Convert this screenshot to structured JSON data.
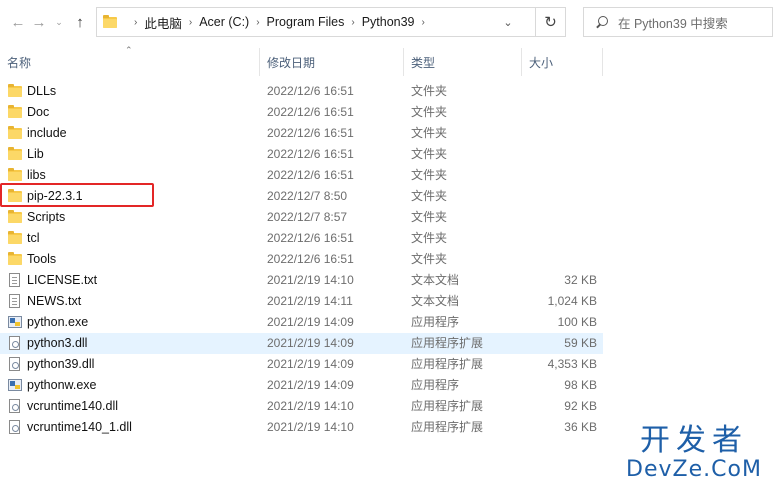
{
  "address_bar": {
    "breadcrumb": [
      "此电脑",
      "Acer (C:)",
      "Program Files",
      "Python39"
    ],
    "search_placeholder": "在 Python39 中搜索"
  },
  "columns": {
    "name": "名称",
    "date": "修改日期",
    "type": "类型",
    "size": "大小"
  },
  "files": [
    {
      "icon": "folder-icon",
      "name": "DLLs",
      "date": "2022/12/6 16:51",
      "type": "文件夹",
      "size": ""
    },
    {
      "icon": "folder-icon",
      "name": "Doc",
      "date": "2022/12/6 16:51",
      "type": "文件夹",
      "size": ""
    },
    {
      "icon": "folder-icon",
      "name": "include",
      "date": "2022/12/6 16:51",
      "type": "文件夹",
      "size": ""
    },
    {
      "icon": "folder-icon",
      "name": "Lib",
      "date": "2022/12/6 16:51",
      "type": "文件夹",
      "size": ""
    },
    {
      "icon": "folder-icon",
      "name": "libs",
      "date": "2022/12/6 16:51",
      "type": "文件夹",
      "size": ""
    },
    {
      "icon": "folder-icon",
      "name": "pip-22.3.1",
      "date": "2022/12/7 8:50",
      "type": "文件夹",
      "size": ""
    },
    {
      "icon": "folder-icon",
      "name": "Scripts",
      "date": "2022/12/7 8:57",
      "type": "文件夹",
      "size": ""
    },
    {
      "icon": "folder-icon",
      "name": "tcl",
      "date": "2022/12/6 16:51",
      "type": "文件夹",
      "size": ""
    },
    {
      "icon": "folder-icon",
      "name": "Tools",
      "date": "2022/12/6 16:51",
      "type": "文件夹",
      "size": ""
    },
    {
      "icon": "text-file-icon",
      "name": "LICENSE.txt",
      "date": "2021/2/19 14:10",
      "type": "文本文档",
      "size": "32 KB"
    },
    {
      "icon": "text-file-icon",
      "name": "NEWS.txt",
      "date": "2021/2/19 14:11",
      "type": "文本文档",
      "size": "1,024 KB"
    },
    {
      "icon": "exe-file-icon",
      "name": "python.exe",
      "date": "2021/2/19 14:09",
      "type": "应用程序",
      "size": "100 KB"
    },
    {
      "icon": "dll-file-icon",
      "name": "python3.dll",
      "date": "2021/2/19 14:09",
      "type": "应用程序扩展",
      "size": "59 KB",
      "selected": true
    },
    {
      "icon": "dll-file-icon",
      "name": "python39.dll",
      "date": "2021/2/19 14:09",
      "type": "应用程序扩展",
      "size": "4,353 KB"
    },
    {
      "icon": "exe-file-icon",
      "name": "pythonw.exe",
      "date": "2021/2/19 14:09",
      "type": "应用程序",
      "size": "98 KB"
    },
    {
      "icon": "dll-file-icon",
      "name": "vcruntime140.dll",
      "date": "2021/2/19 14:10",
      "type": "应用程序扩展",
      "size": "92 KB"
    },
    {
      "icon": "dll-file-icon",
      "name": "vcruntime140_1.dll",
      "date": "2021/2/19 14:10",
      "type": "应用程序扩展",
      "size": "36 KB"
    }
  ],
  "watermark": {
    "cn": "开发者",
    "en": "DevZe.CoM"
  },
  "colors": {
    "accent_highlight": "#e32626",
    "selected_row": "#e5f3ff",
    "folder": "#f7c948",
    "watermark": "#1e5fa8"
  }
}
